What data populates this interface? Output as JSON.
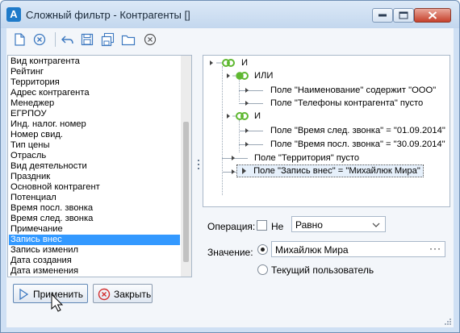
{
  "window": {
    "icon_letter": "A",
    "title": "Сложный фильтр - Контрагенты []"
  },
  "toolbar": {
    "icons": [
      "new-document-icon",
      "clear-icon",
      "undo-icon",
      "save-icon",
      "save-all-icon",
      "open-folder-icon",
      "delete-icon"
    ]
  },
  "fields": {
    "items": [
      "Вид контрагента",
      "Рейтинг",
      "Территория",
      "Адрес контрагента",
      "Менеджер",
      "ЕГРПОУ",
      "Инд. налог. номер",
      "Номер свид.",
      "Тип цены",
      "Отрасль",
      "Вид деятельности",
      "Праздник",
      "Основной контрагент",
      "Потенциал",
      "Время посл. звонка",
      "Время след. звонка",
      "Примечание",
      "Запись внес",
      "Запись изменил",
      "Дата создания",
      "Дата изменения"
    ],
    "selected": "Запись внес"
  },
  "tree": {
    "root": "И",
    "or_group": "ИЛИ",
    "or_items": [
      "Поле \"Наименование\" содержит \"ООО\"",
      "Поле \"Телефоны контрагента\" пусто"
    ],
    "and_group": "И",
    "and_items": [
      "Поле \"Время след. звонка\" = \"01.09.2014\"",
      "Поле \"Время посл. звонка\" = \"30.09.2014\""
    ],
    "territory": "Поле \"Территория\" пусто",
    "selected_item": "Поле \"Запись внес\" = \"Михайлюк Мира\""
  },
  "operation": {
    "label": "Операция:",
    "not_label": "Не",
    "not_checked": false,
    "value": "Равно"
  },
  "value": {
    "label": "Значение:",
    "text": "Михайлюк Мира",
    "dots": "···",
    "current_user": "Текущий пользователь",
    "selected_option": "value"
  },
  "buttons": {
    "apply": "Применить",
    "close": "Закрыть"
  },
  "colors": {
    "selection": "#3399ff",
    "group_icon": "#5fb831",
    "close_icon": "#d32f2f"
  }
}
